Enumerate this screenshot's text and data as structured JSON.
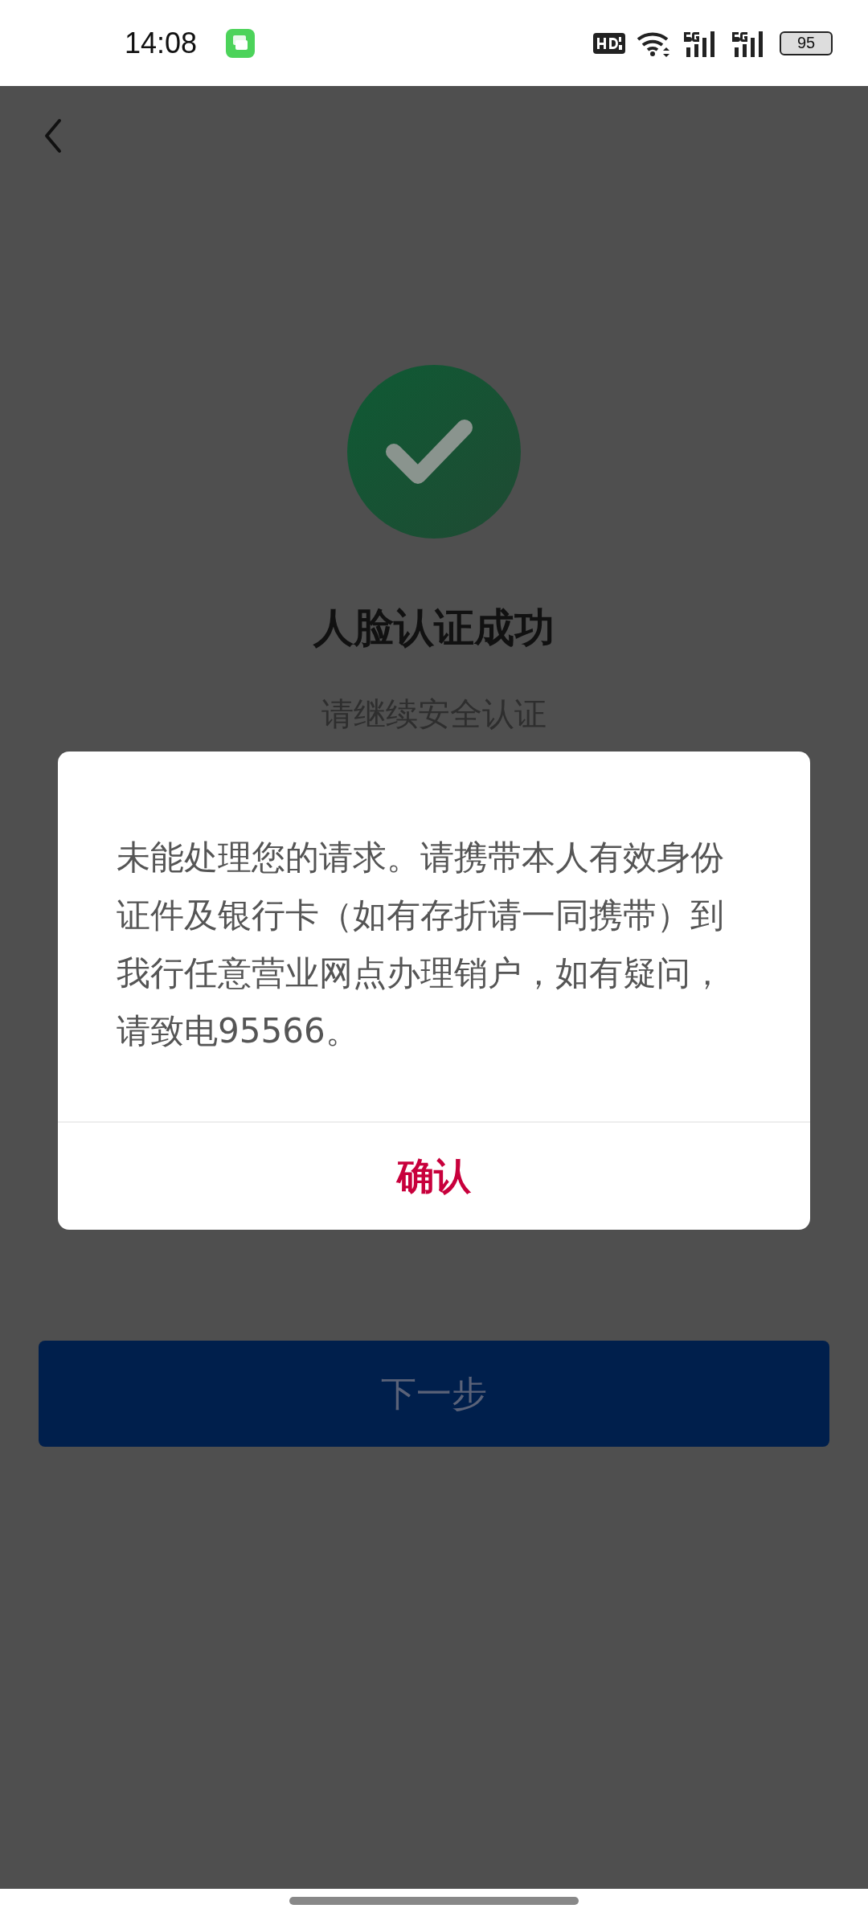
{
  "status_bar": {
    "time": "14:08",
    "battery": "95"
  },
  "page": {
    "title": "人脸认证成功",
    "subtitle": "请继续安全认证",
    "next_button": {
      "label": "下一步",
      "disabled": true
    }
  },
  "dialog": {
    "message": "未能处理您的请求。请携带本人有效身份证件及银行卡（如有存折请一同携带）到我行任意营业网点办理销户，如有疑问，请致电95566。",
    "confirm": "确认"
  }
}
